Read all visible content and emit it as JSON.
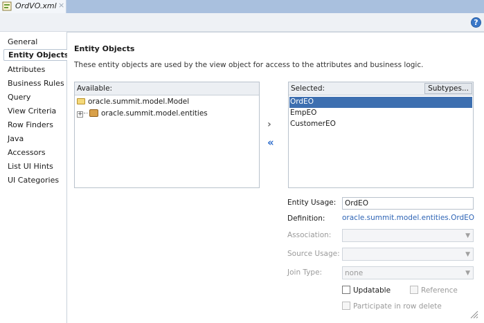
{
  "tab": {
    "title": "OrdVO.xml",
    "close": "×",
    "icon": "xml-file-icon"
  },
  "help_label": "?",
  "nav": [
    {
      "label": "General",
      "selected": false
    },
    {
      "label": "Entity Objects",
      "selected": true
    },
    {
      "label": "Attributes",
      "selected": false
    },
    {
      "label": "Business Rules",
      "selected": false
    },
    {
      "label": "Query",
      "selected": false
    },
    {
      "label": "View Criteria",
      "selected": false
    },
    {
      "label": "Row Finders",
      "selected": false
    },
    {
      "label": "Java",
      "selected": false
    },
    {
      "label": "Accessors",
      "selected": false
    },
    {
      "label": "List UI Hints",
      "selected": false
    },
    {
      "label": "UI Categories",
      "selected": false
    }
  ],
  "page": {
    "title": "Entity Objects",
    "description": "These entity objects are used by the view object for access to the attributes and business logic."
  },
  "available": {
    "header": "Available:",
    "items": [
      {
        "label": "oracle.summit.model.Model",
        "icon": "folder-icon"
      },
      {
        "label": "oracle.summit.model.entities",
        "icon": "package-icon"
      }
    ]
  },
  "shuttle": {
    "add": "›",
    "remove": "«"
  },
  "selected": {
    "header": "Selected:",
    "subtypes": "Subtypes...",
    "items": [
      "OrdEO",
      "EmpEO",
      "CustomerEO"
    ],
    "highlighted": "OrdEO"
  },
  "fields": {
    "entity_usage_label": "Entity Usage:",
    "entity_usage_value": "OrdEO",
    "definition_label": "Definition:",
    "definition_value": "oracle.summit.model.entities.OrdEO",
    "association_label": "Association:",
    "association_value": "",
    "source_usage_label": "Source Usage:",
    "source_usage_value": "",
    "join_type_label": "Join Type:",
    "join_type_value": "none",
    "updatable_label": "Updatable",
    "updatable_checked": false,
    "reference_label": "Reference",
    "reference_checked": false,
    "participate_label": "Participate in row delete",
    "participate_checked": false
  },
  "colors": {
    "tabbar": "#a9c0de",
    "selection": "#3d6fb0",
    "link": "#2e64b5"
  }
}
